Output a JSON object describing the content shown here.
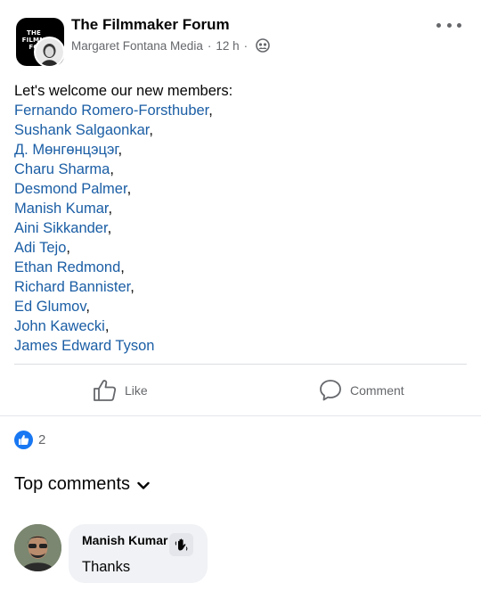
{
  "post": {
    "group_name": "The Filmmaker Forum",
    "group_logo_text": "THE\nFILMMAKER\nFORUM",
    "author": "Margaret Fontana Media",
    "separator": "·",
    "time": "12 h",
    "privacy_icon": "group-audience-icon",
    "more_icon": "more-dots-icon",
    "intro": "Let's welcome our new members:",
    "members": [
      {
        "name": "Fernando Romero-Forsthuber",
        "suffix": ","
      },
      {
        "name": "Sushank Salgaonkar",
        "suffix": ","
      },
      {
        "name": "Д. Мөнгөнцэцэг",
        "suffix": ","
      },
      {
        "name": "Charu Sharma",
        "suffix": ","
      },
      {
        "name": "Desmond Palmer",
        "suffix": ","
      },
      {
        "name": "Manish Kumar",
        "suffix": ","
      },
      {
        "name": "Aini Sikkander",
        "suffix": ","
      },
      {
        "name": "Adi Tejo",
        "suffix": ","
      },
      {
        "name": "Ethan Redmond",
        "suffix": ","
      },
      {
        "name": "Richard Bannister",
        "suffix": ","
      },
      {
        "name": "Ed Glumov",
        "suffix": ","
      },
      {
        "name": "John Kawecki",
        "suffix": ","
      },
      {
        "name": "James Edward Tyson",
        "suffix": ""
      }
    ],
    "member_link_color": "#1b5ea5"
  },
  "actions": {
    "like_label": "Like",
    "comment_label": "Comment",
    "like_icon": "thumbs-up-icon",
    "comment_icon": "comment-bubble-icon"
  },
  "reactions": {
    "icon": "like-reaction-icon",
    "count": "2",
    "color": "#1877f2"
  },
  "comments": {
    "header": "Top comments",
    "items": [
      {
        "author": "Manish Kumar",
        "text": "Thanks",
        "badge_icon": "waving-hand-icon"
      }
    ]
  }
}
